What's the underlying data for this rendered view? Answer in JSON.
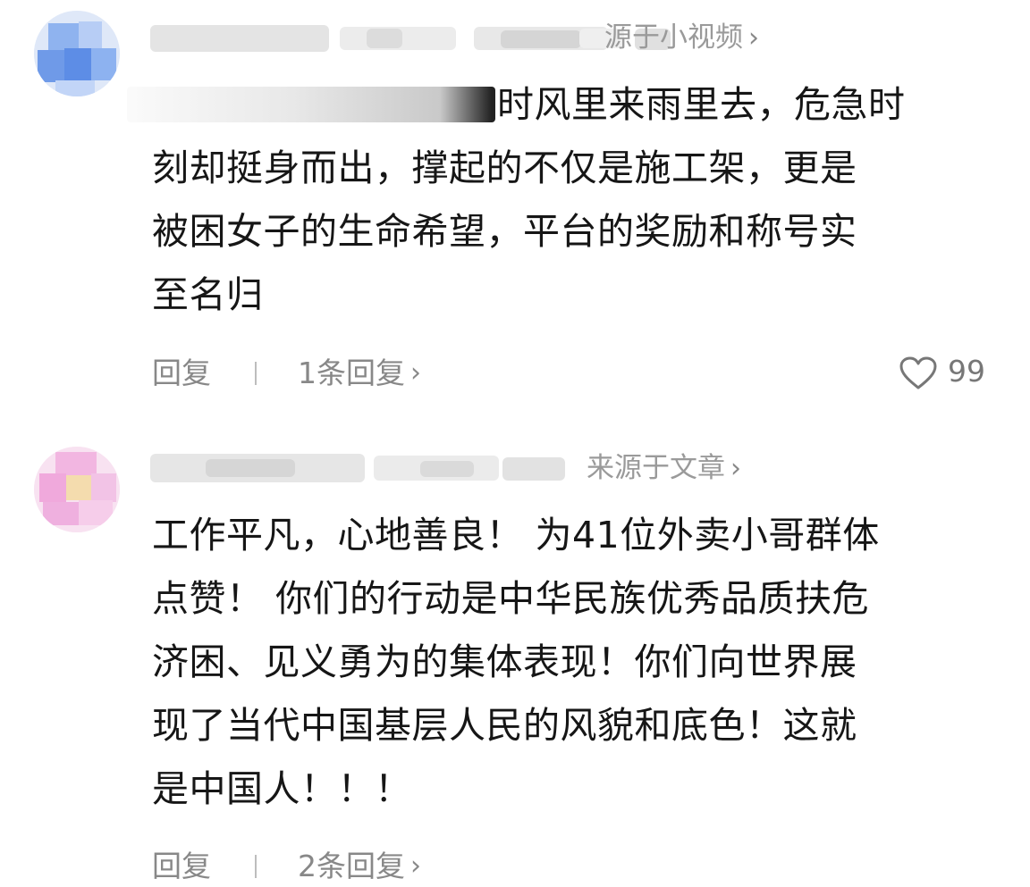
{
  "comments": [
    {
      "meta": {
        "source_label": "源于小视频"
      },
      "lines": [
        "时风里来雨里去，危急时",
        "刻却挺身而出，撑起的不仅是施工架，更是",
        "被困女子的生命希望，平台的奖励和称号实",
        "至名归"
      ],
      "reply_label": "回复",
      "replies_label": "1条回复",
      "like_count": "99",
      "icons": [
        "chevron-right-icon",
        "heart-icon"
      ]
    },
    {
      "meta": {
        "source_label": "来源于文章"
      },
      "lines": [
        "工作平凡，心地善良！ 为41位外卖小哥群体",
        "点赞！ 你们的行动是中华民族优秀品质扶危",
        "济困、见义勇为的集体表现！你们向世界展",
        "现了当代中国基层人民的风貌和底色！这就",
        "是中国人！！！"
      ],
      "reply_label": "回复",
      "replies_label": "2条回复",
      "icons": [
        "chevron-right-icon"
      ]
    }
  ],
  "colors": {
    "text": "#161616",
    "meta": "#9a9a9a",
    "action": "#888888",
    "avatar1": "#7fa8ee",
    "avatar2": "#f3b9e4"
  }
}
